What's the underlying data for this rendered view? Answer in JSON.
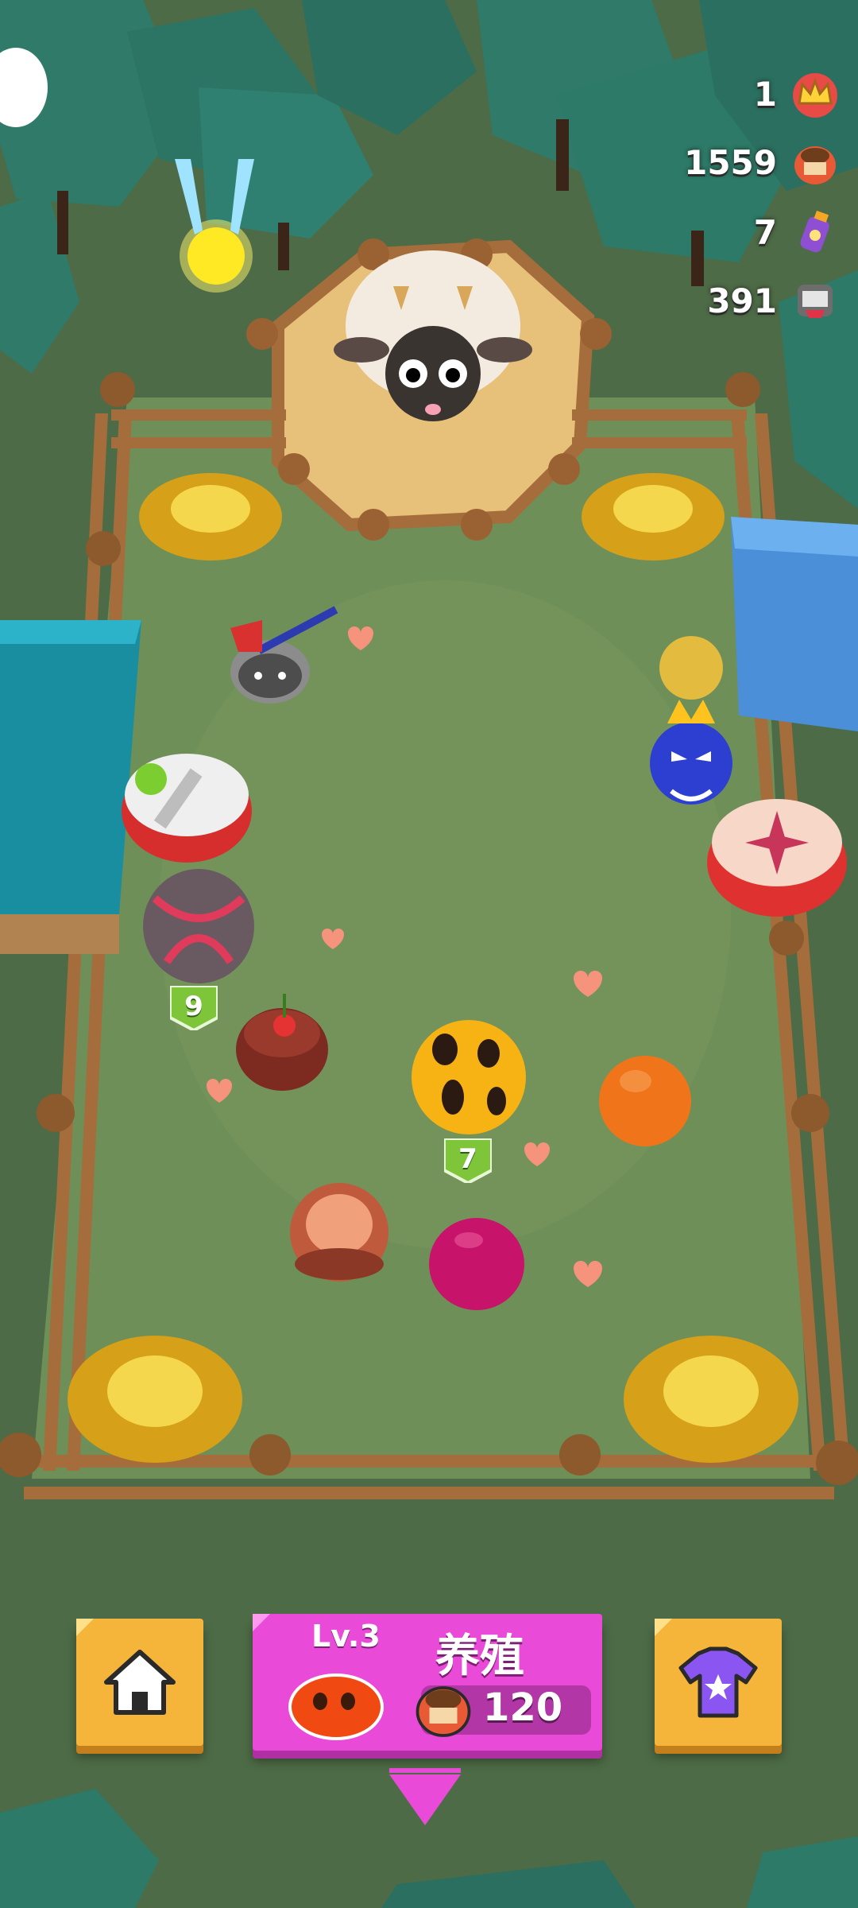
{
  "hud": {
    "crowns": "1",
    "coins": "1559",
    "potions": "7",
    "tokens": "391",
    "icons": [
      "crown-icon",
      "pot-coin-icon",
      "potion-bottle-icon",
      "robot-face-icon"
    ]
  },
  "monsters": {
    "level_tag_left": "9",
    "level_tag_center": "7"
  },
  "buttons": {
    "home_icon": "home-icon",
    "shirt_icon": "tshirt-star-icon"
  },
  "breed": {
    "level": "Lv.3",
    "title": "养殖",
    "price": "120"
  },
  "colors": {
    "grass": "#6f8f58",
    "fence": "#a56d3b",
    "button_orange": "#f5b53a",
    "button_pink": "#e94bd8",
    "level_tag_green": "#7ec53a"
  }
}
